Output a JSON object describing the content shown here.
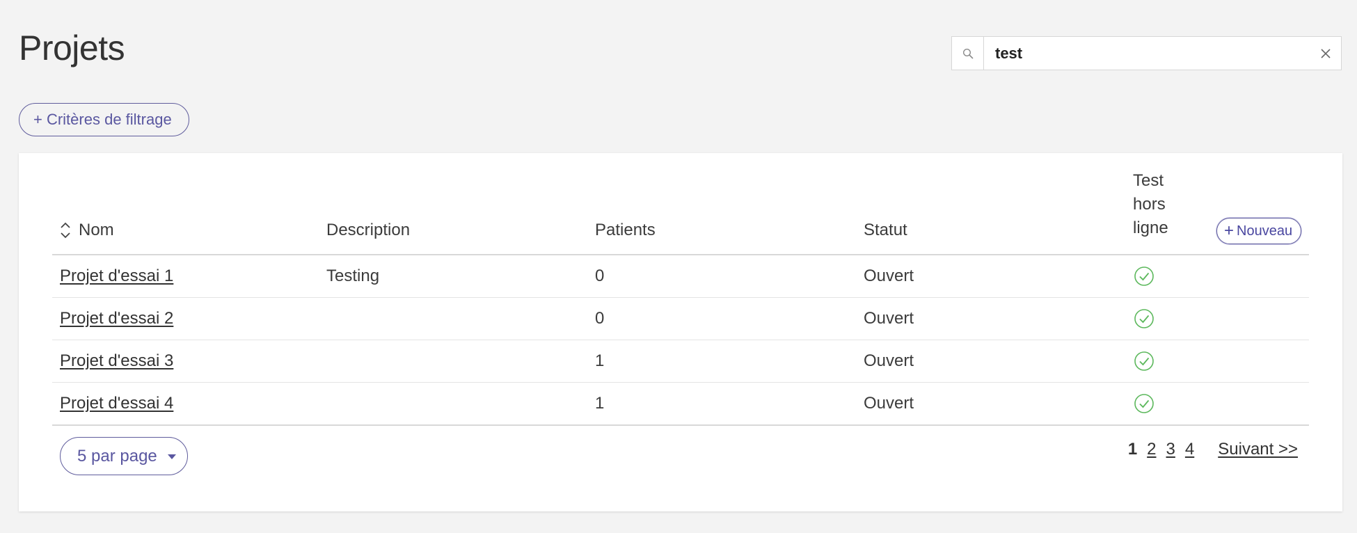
{
  "page": {
    "title": "Projets"
  },
  "search": {
    "value": "test",
    "placeholder": ""
  },
  "filter": {
    "label": "+ Critères de filtrage"
  },
  "table": {
    "headers": {
      "nom": "Nom",
      "description": "Description",
      "patients": "Patients",
      "statut": "Statut",
      "offline": "Test hors ligne"
    },
    "new_button": {
      "plus": "+",
      "label": "Nouveau"
    },
    "rows": [
      {
        "nom": "Projet d'essai 1",
        "description": "Testing",
        "patients": "0",
        "statut": "Ouvert",
        "offline_icon": "check-circle-icon"
      },
      {
        "nom": "Projet d'essai 2",
        "description": "",
        "patients": "0",
        "statut": "Ouvert",
        "offline_icon": "check-circle-icon"
      },
      {
        "nom": "Projet d'essai 3",
        "description": "",
        "patients": "1",
        "statut": "Ouvert",
        "offline_icon": "check-circle-icon"
      },
      {
        "nom": "Projet d'essai 4",
        "description": "",
        "patients": "1",
        "statut": "Ouvert",
        "offline_icon": "check-circle-icon"
      }
    ]
  },
  "pagination": {
    "per_page_label": "5 par page",
    "current": "1",
    "pages": [
      "2",
      "3",
      "4"
    ],
    "next_label": "Suivant >>"
  },
  "colors": {
    "accent": "#5f5c9c",
    "check": "#5cb85c",
    "background": "#f3f3f3"
  }
}
